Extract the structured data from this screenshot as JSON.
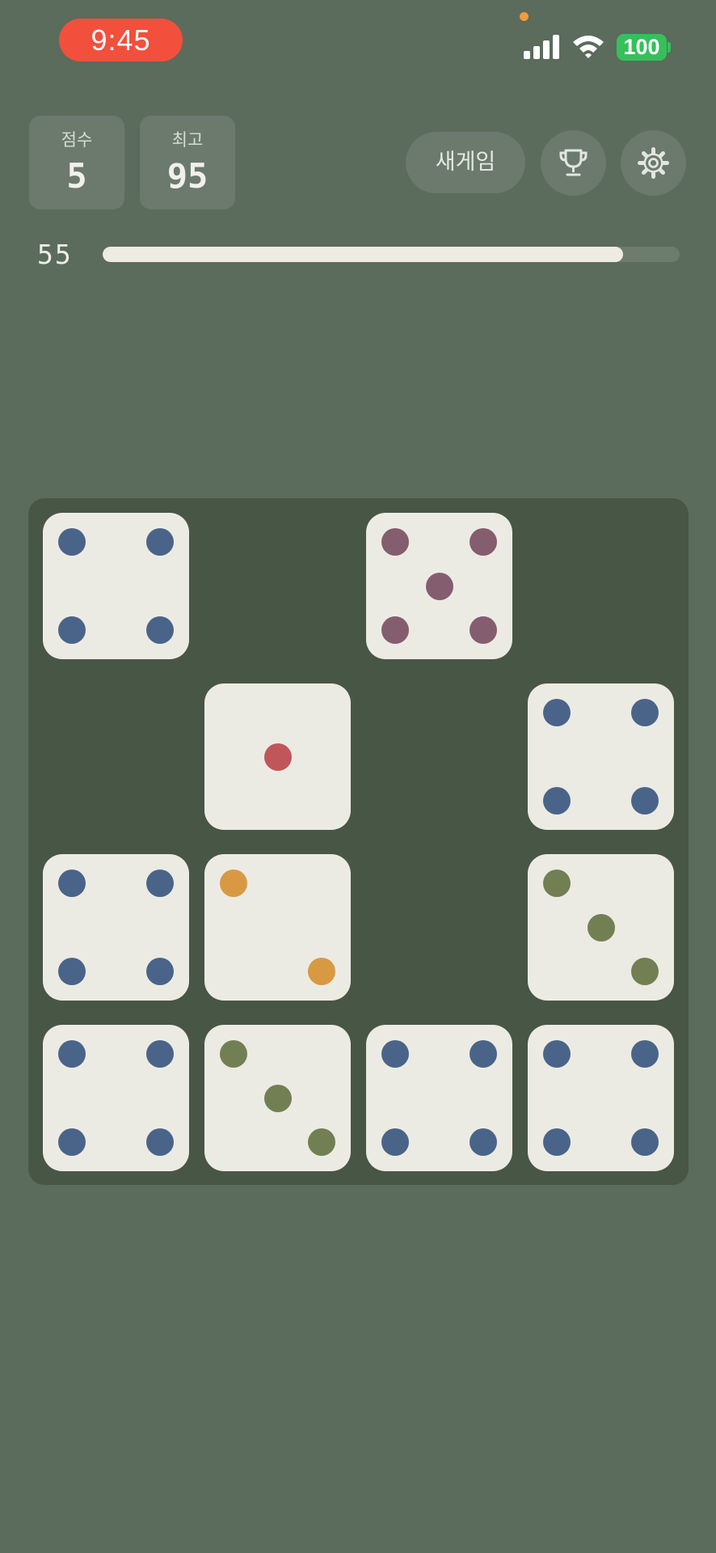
{
  "status_bar": {
    "time": "9:45",
    "battery": "100"
  },
  "scores": {
    "current_label": "점수",
    "current_value": "5",
    "best_label": "최고",
    "best_value": "95"
  },
  "controls": {
    "new_game_label": "새게임",
    "trophy_icon": "trophy-icon",
    "settings_icon": "gear-icon"
  },
  "progress": {
    "label": "55",
    "fraction": 0.902
  },
  "colors": {
    "background": "#5b6b5c",
    "board": "#485645",
    "tile": "#ecebe3",
    "pip_blue": "#4a6489",
    "pip_purple": "#845d6f",
    "pip_red": "#c0565a",
    "pip_orange": "#d99943",
    "pip_olive": "#727f53"
  },
  "board": {
    "rows": 4,
    "cols": 4,
    "cells": [
      {
        "row": 0,
        "col": 0,
        "face": 4,
        "color": "#4a6489"
      },
      {
        "row": 0,
        "col": 2,
        "face": 5,
        "color": "#845d6f"
      },
      {
        "row": 1,
        "col": 1,
        "face": 1,
        "color": "#c0565a"
      },
      {
        "row": 1,
        "col": 3,
        "face": 4,
        "color": "#4a6489"
      },
      {
        "row": 2,
        "col": 0,
        "face": 4,
        "color": "#4a6489"
      },
      {
        "row": 2,
        "col": 1,
        "face": 2,
        "color": "#d99943"
      },
      {
        "row": 2,
        "col": 3,
        "face": 3,
        "color": "#727f53"
      },
      {
        "row": 3,
        "col": 0,
        "face": 4,
        "color": "#4a6489"
      },
      {
        "row": 3,
        "col": 1,
        "face": 3,
        "color": "#727f53"
      },
      {
        "row": 3,
        "col": 2,
        "face": 4,
        "color": "#4a6489"
      },
      {
        "row": 3,
        "col": 3,
        "face": 4,
        "color": "#4a6489"
      }
    ]
  }
}
